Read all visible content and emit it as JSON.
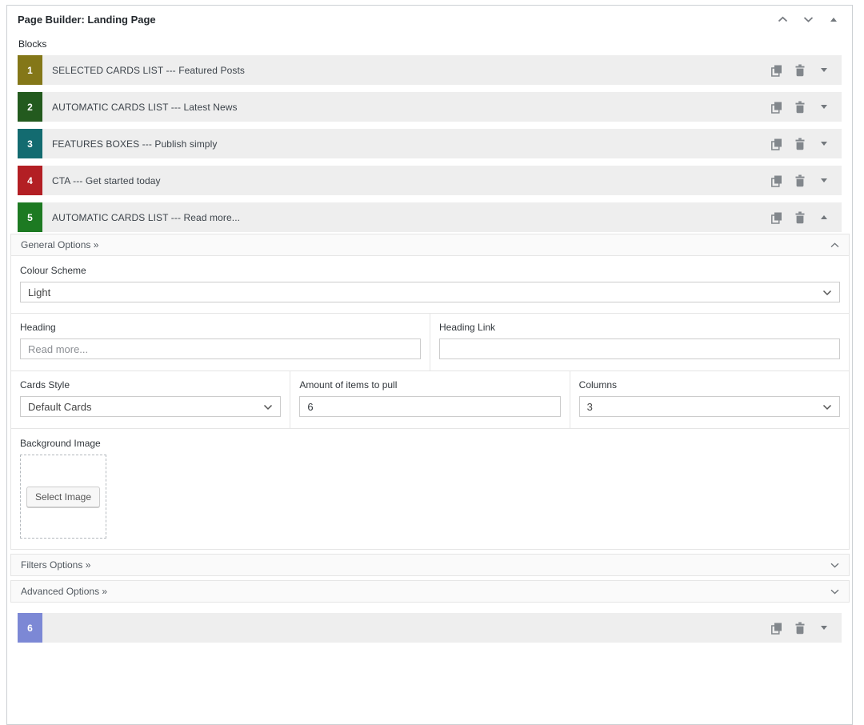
{
  "panel": {
    "title": "Page Builder: Landing Page",
    "blocks_label": "Blocks"
  },
  "blocks": [
    {
      "num": "1",
      "color": "#847718",
      "label": "SELECTED CARDS LIST --- Featured Posts",
      "expanded": false
    },
    {
      "num": "2",
      "color": "#235a1e",
      "label": "AUTOMATIC CARDS LIST --- Latest News",
      "expanded": false
    },
    {
      "num": "3",
      "color": "#136b70",
      "label": "FEATURES BOXES --- Publish simply",
      "expanded": false
    },
    {
      "num": "4",
      "color": "#b31f24",
      "label": "CTA --- Get started today",
      "expanded": false
    },
    {
      "num": "5",
      "color": "#1d7a22",
      "label": "AUTOMATIC CARDS LIST --- Read more...",
      "expanded": true
    },
    {
      "num": "6",
      "color": "#7c88d5",
      "label": "",
      "expanded": false
    }
  ],
  "settings": {
    "general_header": "General Options »",
    "filters_header": "Filters Options »",
    "advanced_header": "Advanced Options »",
    "colour_scheme": {
      "label": "Colour Scheme",
      "value": "Light"
    },
    "heading": {
      "label": "Heading",
      "placeholder": "Read more..."
    },
    "heading_link": {
      "label": "Heading Link",
      "value": ""
    },
    "cards_style": {
      "label": "Cards Style",
      "value": "Default Cards"
    },
    "amount": {
      "label": "Amount of items to pull",
      "value": "6"
    },
    "columns": {
      "label": "Columns",
      "value": "3"
    },
    "background_image": {
      "label": "Background Image",
      "button_label": "Select Image"
    }
  },
  "icons": {
    "duplicate": "copy-icon",
    "delete": "trash-icon",
    "toggle": "triangle-icon",
    "move_up": "chevron-up-icon",
    "move_down": "chevron-down-icon",
    "icon_color": "#82878c"
  }
}
